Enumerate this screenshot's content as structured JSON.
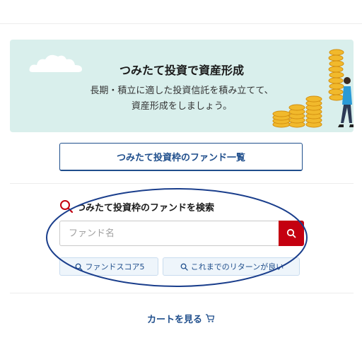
{
  "banner": {
    "title": "つみたて投資で資産形成",
    "line1": "長期・積立に適した投資信託を積み立てて、",
    "line2": "資産形成をしましょう。"
  },
  "list_button": {
    "label": "つみたて投資枠のファンド一覧"
  },
  "search": {
    "heading": "つみたて投資枠のファンドを検索",
    "placeholder": "ファンド名",
    "chips": [
      {
        "label": "ファンドスコア5"
      },
      {
        "label": "これまでのリターンが良い"
      }
    ]
  },
  "cart": {
    "label": "カートを見る"
  },
  "colors": {
    "accent_blue": "#1f4e8c",
    "search_red": "#c40010",
    "banner_bg": "#d9efec",
    "annotation": "#1a3e8c"
  }
}
